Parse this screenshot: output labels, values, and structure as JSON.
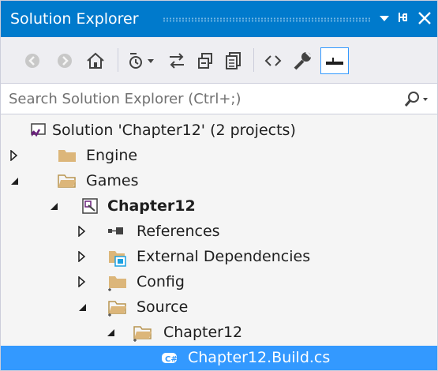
{
  "window": {
    "title": "Solution Explorer"
  },
  "search": {
    "placeholder": "Search Solution Explorer (Ctrl+;)"
  },
  "icons": {
    "title_bar": [
      "dropdown-arrow-icon",
      "pin-icon",
      "close-icon"
    ],
    "toolbar": [
      "back-icon",
      "forward-icon",
      "home-icon",
      "pending-changes-icon",
      "sync-icon",
      "collapse-all-icon",
      "show-all-files-icon",
      "view-code-icon",
      "properties-icon",
      "preview-icon"
    ],
    "search": "search-icon"
  },
  "tree": [
    {
      "label": "Solution 'Chapter12' (2 projects)",
      "icon": "solution-icon",
      "expander": "none",
      "bold": false
    },
    {
      "label": "Engine",
      "icon": "folder-icon",
      "expander": "collapsed",
      "bold": false
    },
    {
      "label": "Games",
      "icon": "folder-open-icon",
      "expander": "expanded",
      "bold": false
    },
    {
      "label": "Chapter12",
      "icon": "project-icon",
      "expander": "expanded",
      "bold": true
    },
    {
      "label": "References",
      "icon": "references-icon",
      "expander": "collapsed",
      "bold": false
    },
    {
      "label": "External Dependencies",
      "icon": "external-dependencies-icon",
      "expander": "collapsed",
      "bold": false
    },
    {
      "label": "Config",
      "icon": "folder-icon",
      "expander": "collapsed",
      "bold": false
    },
    {
      "label": "Source",
      "icon": "folder-open-icon",
      "expander": "expanded",
      "bold": false
    },
    {
      "label": "Chapter12",
      "icon": "folder-open-icon",
      "expander": "expanded",
      "bold": false
    },
    {
      "label": "Chapter12.Build.cs",
      "icon": "csharp-file-icon",
      "expander": "none",
      "bold": false,
      "selected": true
    }
  ],
  "colors": {
    "accent": "#007acc",
    "selection": "#3399ff",
    "folder": "#dcb67a",
    "background": "#f5f5f5"
  }
}
